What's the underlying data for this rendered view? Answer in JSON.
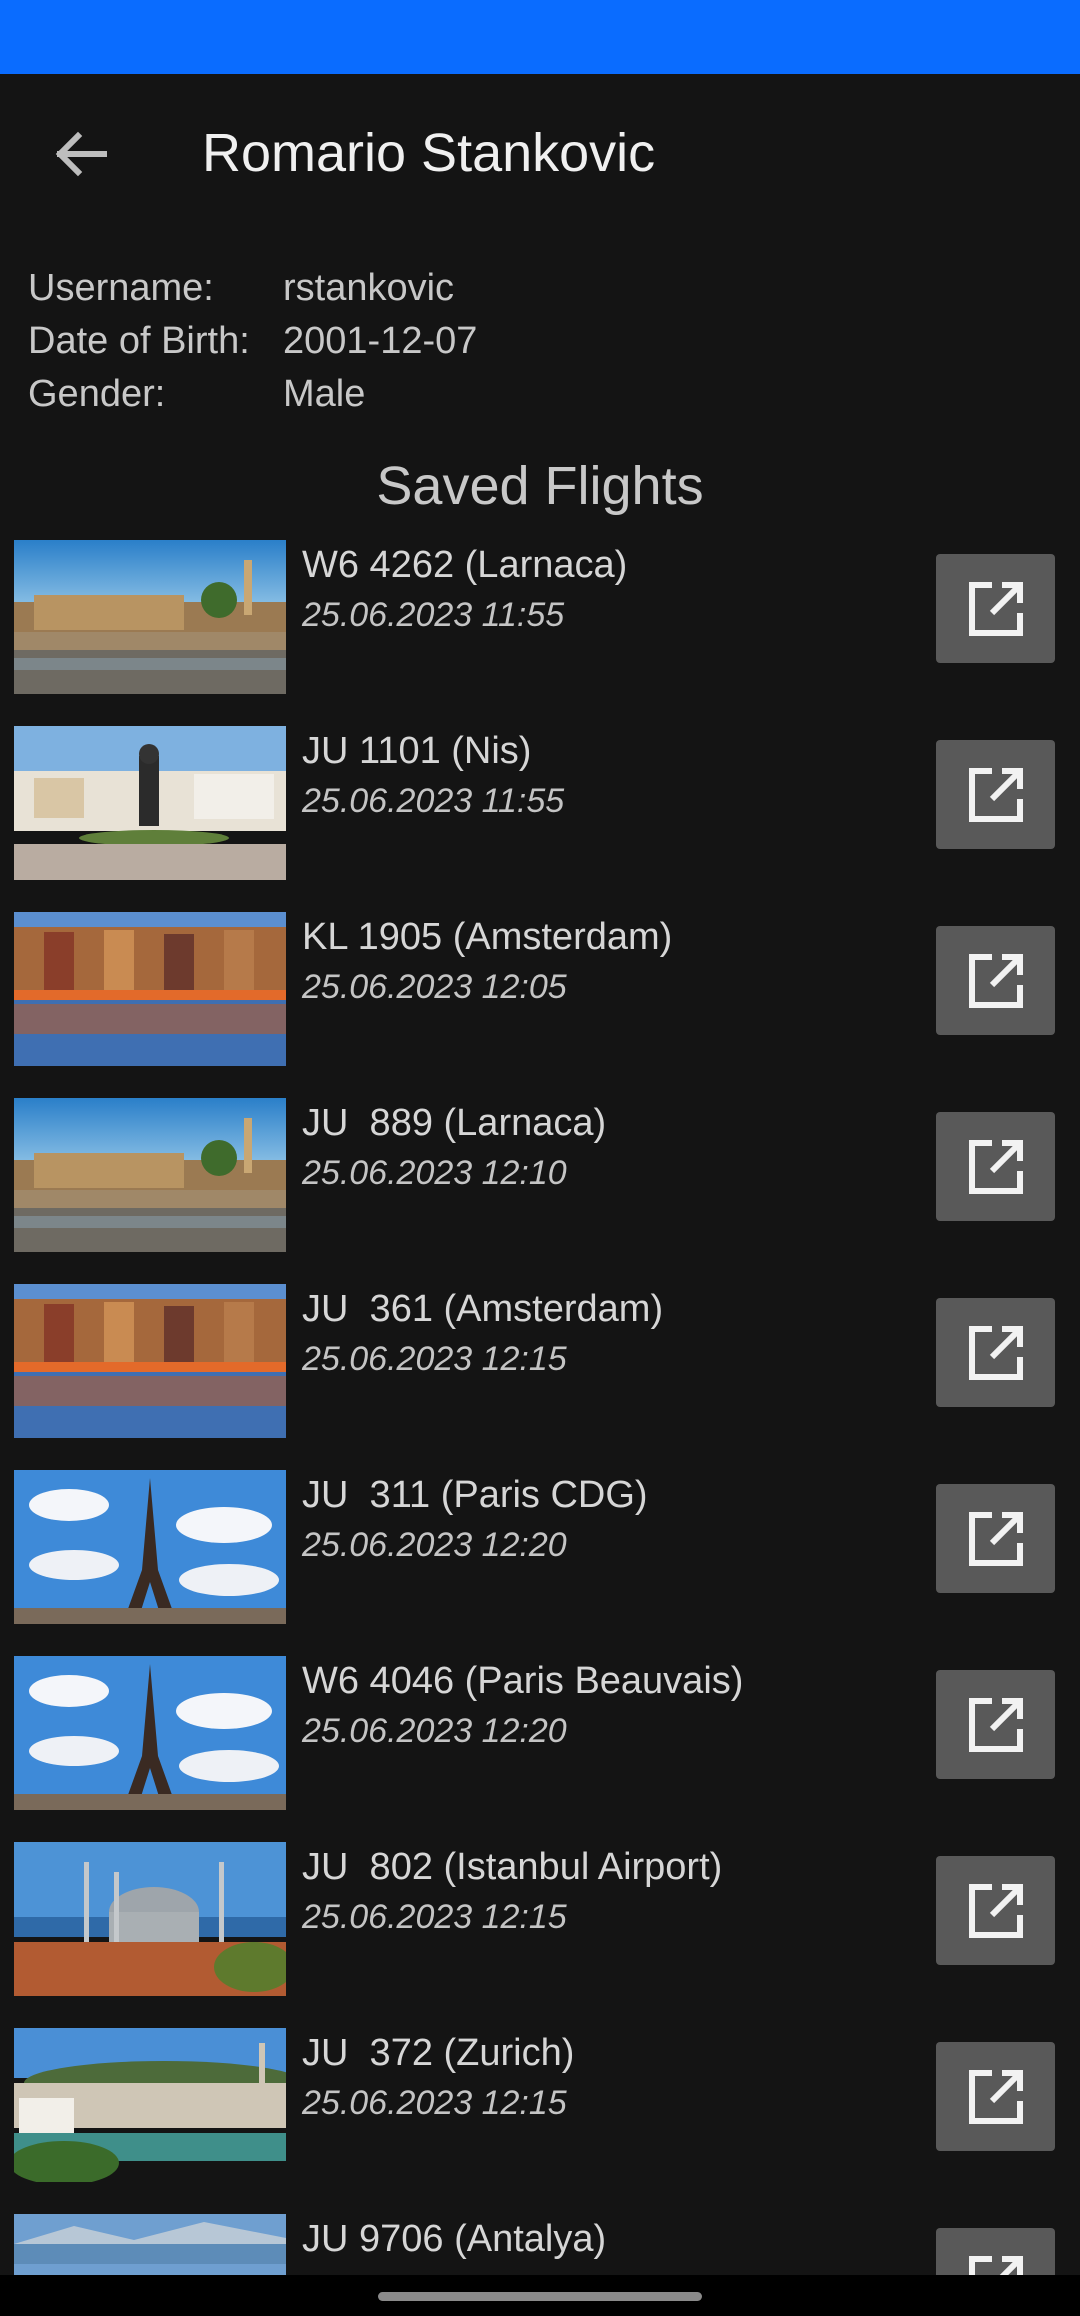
{
  "header": {
    "title": "Romario Stankovic",
    "back_icon": "arrow-back-icon"
  },
  "profile": {
    "username_label": "Username:",
    "username": "rstankovic",
    "dob_label": "Date of Birth:",
    "dob": "2001-12-07",
    "gender_label": "Gender:",
    "gender": "Male"
  },
  "saved_flights": {
    "title": "Saved Flights",
    "open_icon": "open-in-new-icon",
    "items": [
      {
        "flight": "W6 4262 (Larnaca)",
        "time": "25.06.2023 11:55",
        "image": "larnaca-fort-photo"
      },
      {
        "flight": "JU 1101 (Nis)",
        "time": "25.06.2023 11:55",
        "image": "nis-square-photo"
      },
      {
        "flight": "KL 1905 (Amsterdam)",
        "time": "25.06.2023 12:05",
        "image": "amsterdam-canal-photo"
      },
      {
        "flight": "JU  889 (Larnaca)",
        "time": "25.06.2023 12:10",
        "image": "larnaca-fort-photo"
      },
      {
        "flight": "JU  361 (Amsterdam)",
        "time": "25.06.2023 12:15",
        "image": "amsterdam-canal-photo"
      },
      {
        "flight": "JU  311 (Paris CDG)",
        "time": "25.06.2023 12:20",
        "image": "eiffel-tower-photo"
      },
      {
        "flight": "W6 4046 (Paris Beauvais)",
        "time": "25.06.2023 12:20",
        "image": "eiffel-tower-photo"
      },
      {
        "flight": "JU  802 (Istanbul Airport)",
        "time": "25.06.2023 12:15",
        "image": "istanbul-mosque-photo"
      },
      {
        "flight": "JU  372 (Zurich)",
        "time": "25.06.2023 12:15",
        "image": "zurich-lake-photo"
      },
      {
        "flight": "JU 9706 (Antalya)",
        "time": "",
        "image": "antalya-coast-photo"
      }
    ]
  },
  "colors": {
    "status_bar": "#0a6cff",
    "background": "#141414",
    "button": "#595959"
  }
}
